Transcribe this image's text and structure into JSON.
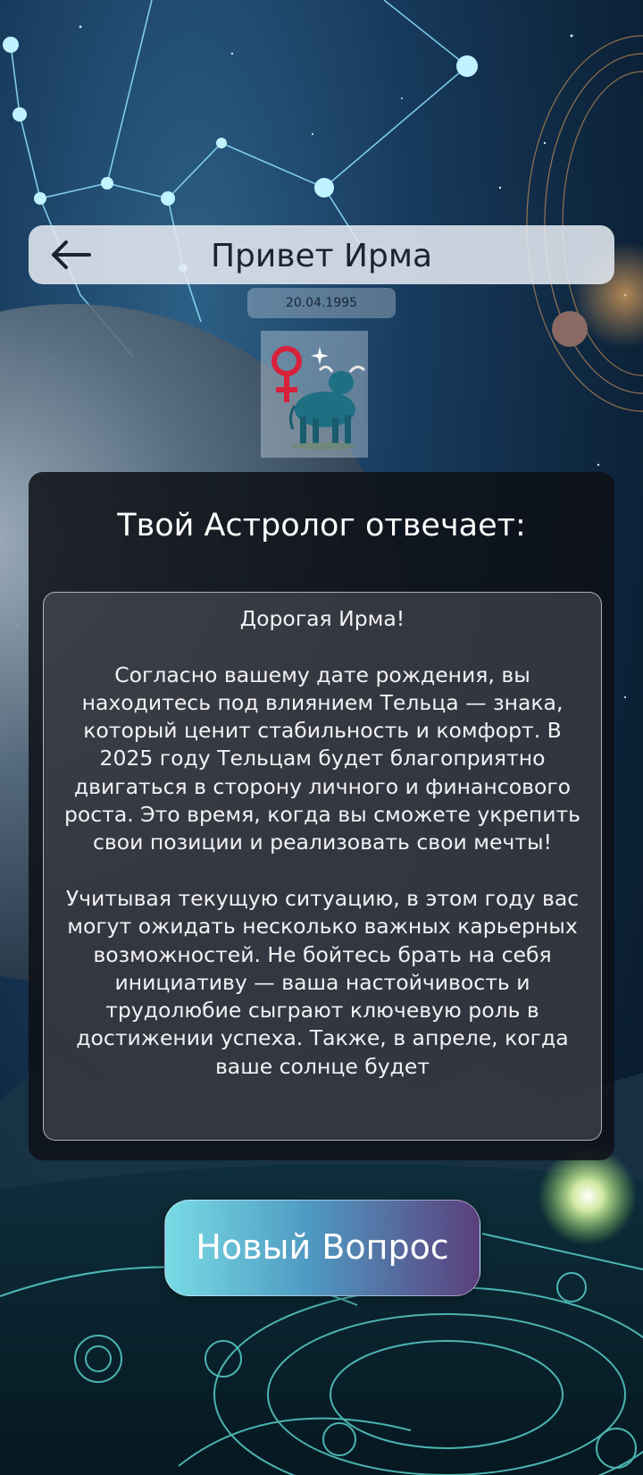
{
  "header": {
    "title": "Привет Ирма",
    "back_icon": "arrow-left-icon"
  },
  "birth_date": "20.04.1995",
  "zodiac": {
    "icons": [
      "venus-icon",
      "sparkle-icon",
      "bull-icon"
    ]
  },
  "answer": {
    "title": "Твой Астролог отвечает:",
    "text": "Дорогая Ирма!\n\nСогласно вашему дате рождения, вы находитесь под влиянием Тельца — знака, который ценит стабильность и комфорт. В 2025 году Тельцам будет благоприятно двигаться в сторону личного и финансового роста. Это время, когда вы сможете укрепить свои позиции и реализовать свои мечты!\n\nУчитывая текущую ситуацию, в этом году вас могут ожидать несколько важных карьерных возможностей. Не бойтесь брать на себя инициативу — ваша настойчивость и трудолюбие сыграют ключевую роль в достижении успеха. Также, в апреле, когда ваше солнце будет"
  },
  "actions": {
    "new_question": "Новый Вопрос"
  },
  "colors": {
    "accent_start": "#79dbe5",
    "accent_end": "#5b3f7d",
    "venus": "#d8213a"
  }
}
